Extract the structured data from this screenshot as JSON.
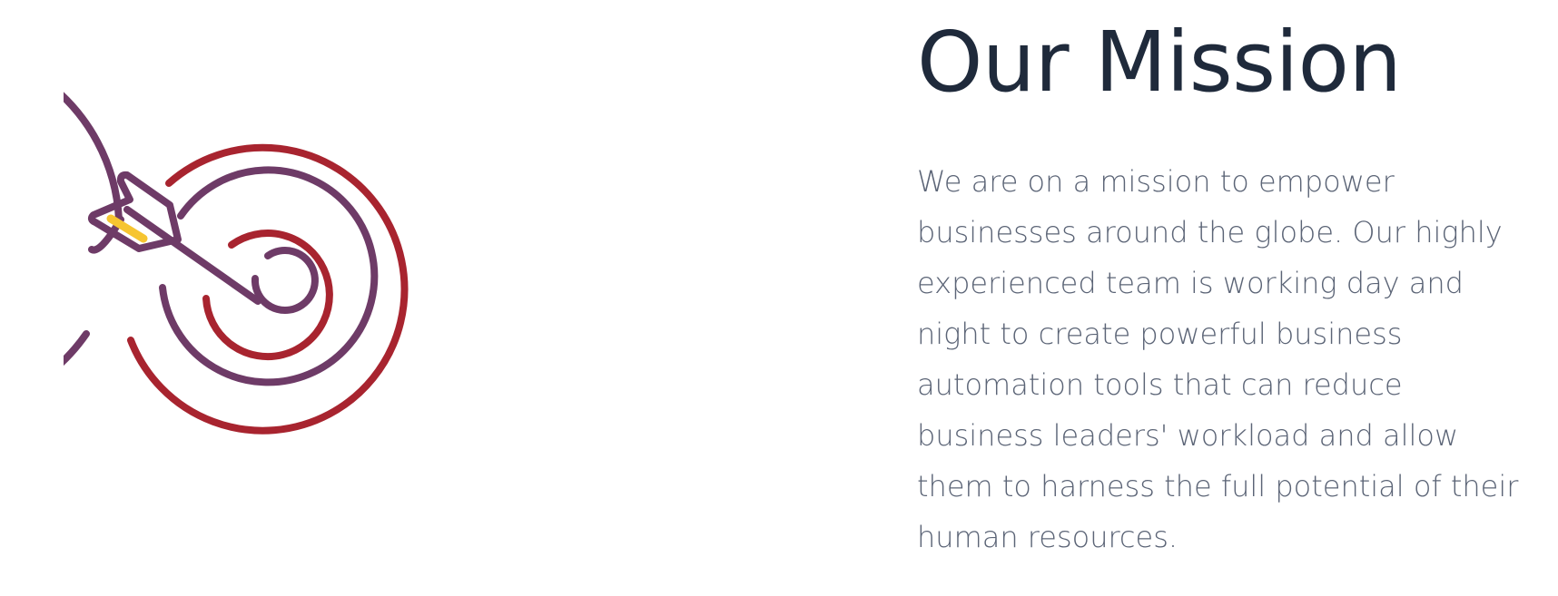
{
  "mission": {
    "title": "Our Mission",
    "body": "We are on a mission to empower businesses around the globe. Our highly experienced team is working day and night to create powerful business automation tools that can reduce business leaders' workload and allow them to harness the full potential of their human resources."
  },
  "illustration": {
    "icon": "target-with-arrow-icon",
    "colors": {
      "purple": "#6e3b67",
      "red": "#a8242f",
      "yellow": "#f6c531"
    }
  }
}
